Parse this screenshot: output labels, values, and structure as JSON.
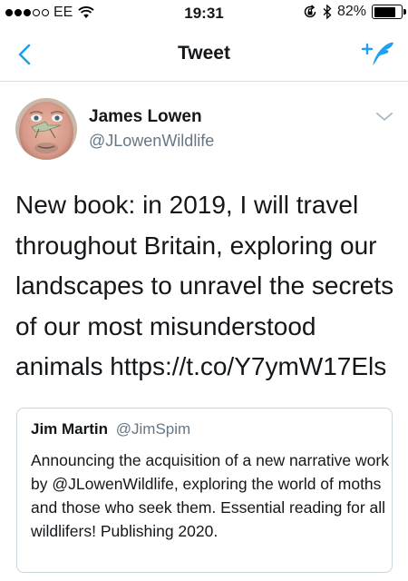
{
  "status_bar": {
    "carrier": "EE",
    "time": "19:31",
    "battery_percent_label": "82%",
    "battery_level": 0.82,
    "icons": [
      "signal-dots-icon",
      "wifi-icon",
      "orientation-lock-icon",
      "bluetooth-icon",
      "battery-icon"
    ]
  },
  "nav": {
    "title": "Tweet",
    "back_icon": "chevron-left-icon",
    "compose_icon": "compose-tweet-icon",
    "accent_color": "#1da1f2"
  },
  "tweet": {
    "author_name": "James Lowen",
    "author_handle": "@JLowenWildlife",
    "text": "New book: in 2019, I will travel throughout Britain, exploring our landscapes to unravel the secrets of our most misunderstood animals https://t.co/Y7ymW17Els",
    "menu_icon": "chevron-down-icon"
  },
  "quoted_tweet": {
    "author_name": "Jim Martin",
    "author_handle": "@JimSpim",
    "text": "Announcing the acquisition of a new narrative work by @JLowenWildlife, exploring the world of moths and those who seek them. Essential reading for all wildlifers! Publishing 2020."
  }
}
